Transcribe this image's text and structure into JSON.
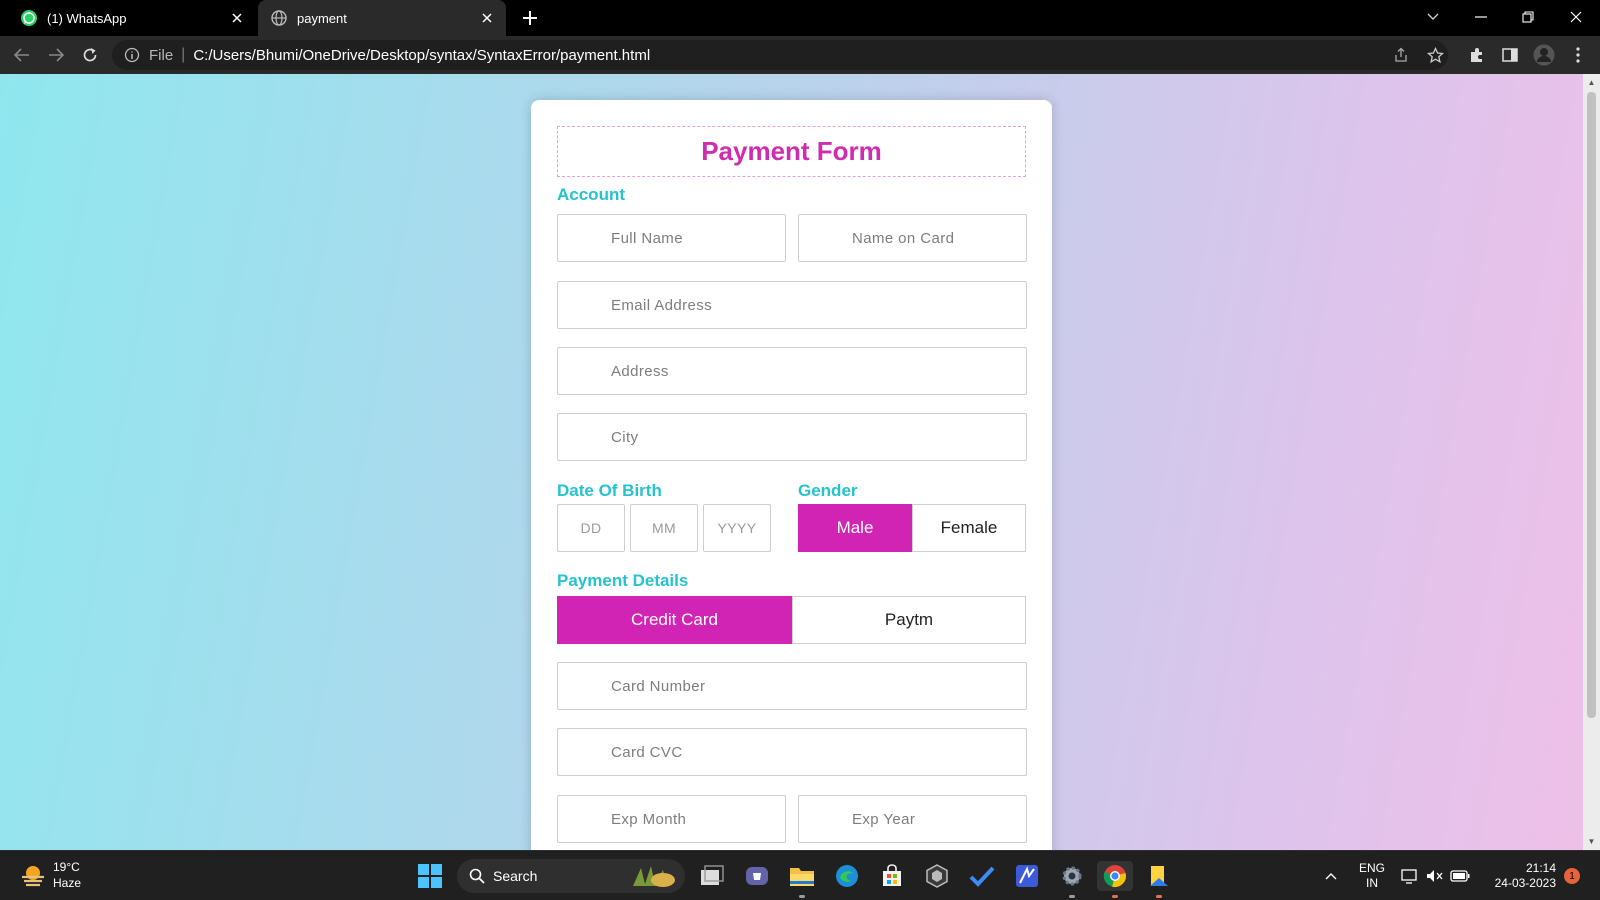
{
  "browser": {
    "tabs": [
      {
        "label": "(1) WhatsApp",
        "favicon": "whatsapp-icon",
        "active": false
      },
      {
        "label": "payment",
        "favicon": "globe-icon",
        "active": true
      }
    ],
    "address": {
      "scheme": "File",
      "url": "C:/Users/Bhumi/OneDrive/Desktop/syntax/SyntaxError/payment.html"
    }
  },
  "form": {
    "title": "Payment Form",
    "account_label": "Account",
    "full_name_placeholder": "Full Name",
    "name_on_card_placeholder": "Name on Card",
    "email_placeholder": "Email Address",
    "address_placeholder": "Address",
    "city_placeholder": "City",
    "dob_label": "Date Of Birth",
    "dob_dd": "DD",
    "dob_mm": "MM",
    "dob_yyyy": "YYYY",
    "gender_label": "Gender",
    "gender_options": [
      "Male",
      "Female"
    ],
    "gender_selected": "Male",
    "payment_label": "Payment Details",
    "payment_options": [
      "Credit Card",
      "Paytm"
    ],
    "payment_selected": "Credit Card",
    "card_number_placeholder": "Card Number",
    "card_cvc_placeholder": "Card CVC",
    "exp_month_placeholder": "Exp Month",
    "exp_year_placeholder": "Exp Year"
  },
  "colors": {
    "accent": "#d224b4",
    "title": "#cf2cb0",
    "section": "#25c2d0"
  },
  "taskbar": {
    "weather_temp": "19°C",
    "weather_condition": "Haze",
    "search_label": "Search",
    "language": "ENG",
    "region": "IN",
    "time": "21:14",
    "date": "24-03-2023",
    "notification_count": "1"
  }
}
